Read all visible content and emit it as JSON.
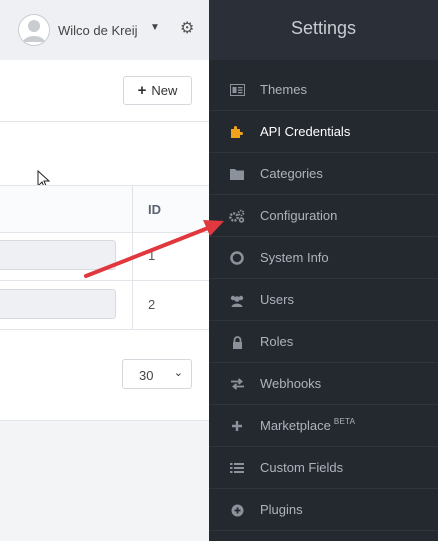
{
  "user": {
    "name": "Wilco de Kreij"
  },
  "toolbar": {
    "new_label": "New"
  },
  "table": {
    "id_header": "ID",
    "rows": [
      {
        "id": "1"
      },
      {
        "id": "2"
      }
    ]
  },
  "pagination": {
    "per_page": "30"
  },
  "sidebar": {
    "title": "Settings",
    "items": [
      {
        "label": "Themes",
        "icon": "themes-icon",
        "active": false
      },
      {
        "label": "API Credentials",
        "icon": "puzzle-icon",
        "active": true
      },
      {
        "label": "Categories",
        "icon": "folder-icon",
        "active": false
      },
      {
        "label": "Configuration",
        "icon": "cogs-icon",
        "active": false
      },
      {
        "label": "System Info",
        "icon": "life-ring-icon",
        "active": false
      },
      {
        "label": "Users",
        "icon": "users-icon",
        "active": false
      },
      {
        "label": "Roles",
        "icon": "lock-icon",
        "active": false
      },
      {
        "label": "Webhooks",
        "icon": "exchange-icon",
        "active": false
      },
      {
        "label": "Marketplace",
        "badge": "BETA",
        "icon": "plus-icon",
        "active": false
      },
      {
        "label": "Custom Fields",
        "icon": "list-icon",
        "active": false
      },
      {
        "label": "Plugins",
        "icon": "plus-circle-icon",
        "active": false
      }
    ]
  },
  "colors": {
    "sidebar_bg": "#242930",
    "active_icon": "#f0a21a",
    "annotation_arrow": "#e0383e"
  }
}
